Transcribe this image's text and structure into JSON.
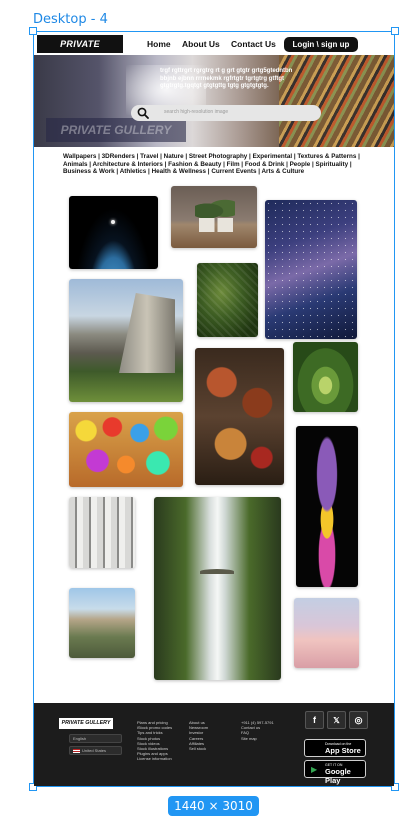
{
  "canvas": {
    "frame_label": "Desktop - 4",
    "size_badge": "1440 × 3010"
  },
  "nav": {
    "logo": "PRIVATE GULLERY",
    "links": [
      "Home",
      "About Us",
      "Contact Us"
    ],
    "login_label": "Login \\ sign up"
  },
  "hero": {
    "text": "trgf rgttrgrt  rgrgtrg rt  g  grt gtgtr grtg5gtedntbn bbjnb ejbnn rrrnekmk rgfrtgtr tgrtgtrg gtftgt gtgtrgtg.tgqtgt gtgtgttg tgtg gtgtgtgtg.",
    "watermark": "PRIVATE GULLERY",
    "search_placeholder": "search high-resolution image"
  },
  "categories": [
    "Wallpapers",
    "3DRenders",
    "Travel",
    "Nature",
    "Street Photography",
    "Experimental",
    "Textures & Patterns",
    "Animals",
    "Architecture & Interiors",
    "Fashion & Beauty",
    "Film",
    "Food & Drink",
    "People",
    "Spirituality",
    "Business & Work",
    "Athletics",
    "Health & Wellness",
    "Current Events",
    "Arts & Culture"
  ],
  "gallery": [
    "astronaut",
    "potted-plants",
    "starry-sky",
    "yosemite-cliff",
    "leaves",
    "grilled-food",
    "green-meadow",
    "colorful-balls",
    "abstract-hands",
    "white-building",
    "waterfall",
    "pink-sunset",
    "street-scene"
  ],
  "footer": {
    "logo": "PRIVATE GULLERY",
    "language": "English",
    "region": "United States",
    "col1": [
      "Plans and pricing",
      "iStock promo codes",
      "Tips and tricks",
      "Stock photos",
      "Stock videos",
      "Stock illustrations",
      "Plugins and apps",
      "License information"
    ],
    "col2": [
      "About us",
      "Newsroom",
      "Investor",
      "Careers",
      "Affiliates",
      "Sell stock"
    ],
    "col3": [
      "+911 (4) 597-5791",
      "Contact us",
      "FAQ",
      "Site map"
    ],
    "social": [
      "f",
      "𝕏",
      "◎"
    ],
    "app_store": {
      "small": "Download on the",
      "big": "App Store",
      "glyph": ""
    },
    "google_play": {
      "small": "GET IT ON",
      "big": "Google Play",
      "glyph": "▶"
    }
  },
  "colors": {
    "accent": "#2196f3",
    "nav_dark": "#111111",
    "footer_bg": "#1c1c1c"
  }
}
